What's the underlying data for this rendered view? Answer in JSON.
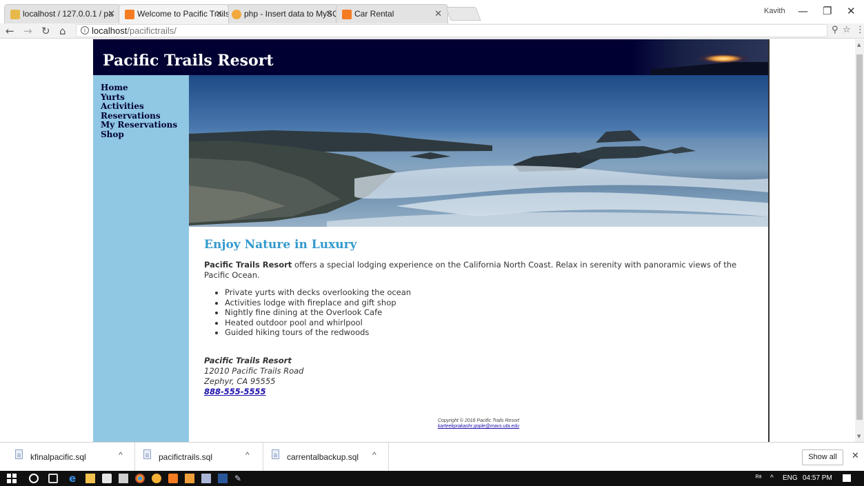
{
  "browser": {
    "tabs": [
      {
        "title": "localhost / 127.0.0.1 / pa"
      },
      {
        "title": "Welcome to Pacific Trails"
      },
      {
        "title": "php - Insert data to MySQ"
      },
      {
        "title": "Car Rental"
      }
    ],
    "user": "Kavith",
    "address": {
      "host": "localhost",
      "path": "/pacifictrails/"
    }
  },
  "page": {
    "site_title": "Pacific Trails Resort",
    "nav": [
      "Home",
      "Yurts",
      "Activities",
      "Reservations",
      "My Reservations",
      "Shop"
    ],
    "heading": "Enjoy Nature in Luxury",
    "intro_bold": "Pacific Trails Resort",
    "intro_text": " offers a special lodging experience on the California North Coast. Relax in serenity with panoramic views of the Pacific Ocean.",
    "features": [
      "Private yurts with decks overlooking the ocean",
      "Activities lodge with fireplace and gift shop",
      "Nightly fine dining at the Overlook Cafe",
      "Heated outdoor pool and whirlpool",
      "Guided hiking tours of the redwoods"
    ],
    "address": {
      "name": "Pacific Trails Resort",
      "street": "12010 Pacific Trails Road",
      "city": "Zephyr, CA 95555",
      "phone": "888-555-5555"
    },
    "footer": {
      "copyright": "Copyright © 2018 Pacific Trails Resort",
      "email": "karteekprakashr.gople@mavs.uta.edu"
    }
  },
  "downloads": {
    "items": [
      "kfinalpacific.sql",
      "pacifictrails.sql",
      "carrentalbackup.sql"
    ],
    "show_all": "Show all"
  },
  "taskbar": {
    "language": "ENG",
    "time": "04:57 PM"
  },
  "colors": {
    "header_bg": "#000033",
    "nav_bg": "#90c7e3",
    "heading": "#3399cc"
  }
}
